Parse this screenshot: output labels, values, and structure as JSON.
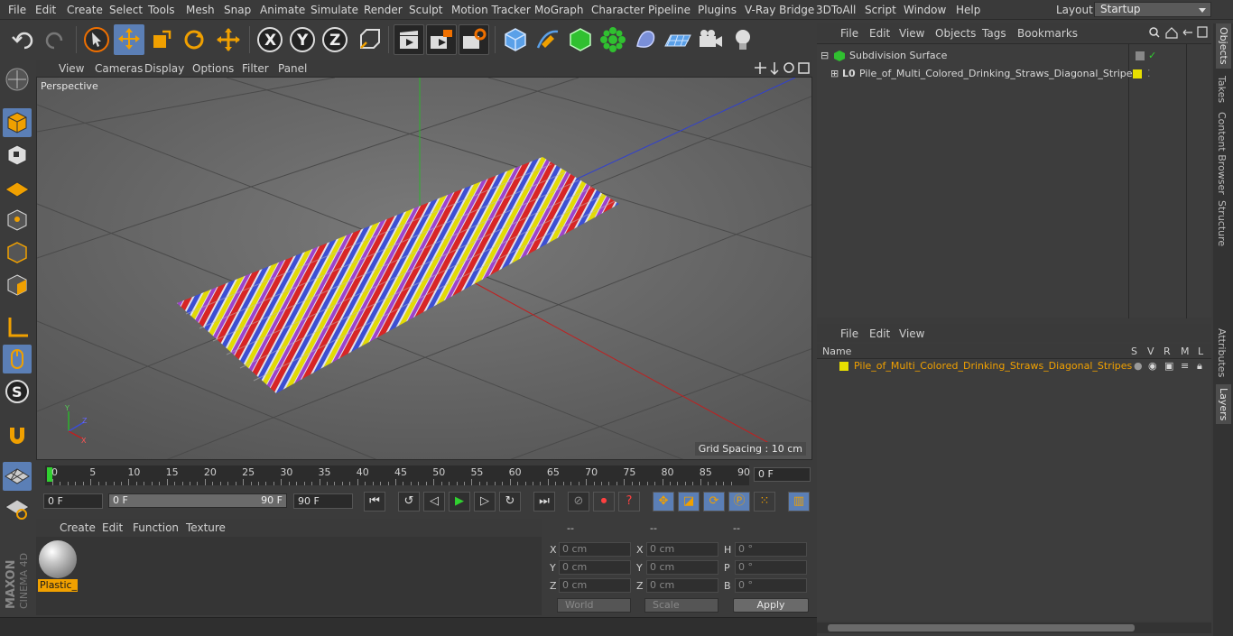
{
  "menu": [
    "File",
    "Edit",
    "Create",
    "Select",
    "Tools",
    "Mesh",
    "Snap",
    "Animate",
    "Simulate",
    "Render",
    "Sculpt",
    "Motion Tracker",
    "MoGraph",
    "Character",
    "Pipeline",
    "Plugins",
    "V-Ray Bridge",
    "3DToAll",
    "Script",
    "Window",
    "Help"
  ],
  "layout": {
    "label": "Layout:",
    "value": "Startup"
  },
  "viewport": {
    "menu": [
      "View",
      "Cameras",
      "Display",
      "Options",
      "Filter",
      "Panel"
    ],
    "camera_label": "Perspective",
    "grid_spacing": "Grid Spacing : 10 cm"
  },
  "timeline": {
    "ticks": [
      "0",
      "5",
      "10",
      "15",
      "20",
      "25",
      "30",
      "35",
      "40",
      "45",
      "50",
      "55",
      "60",
      "65",
      "70",
      "75",
      "80",
      "85",
      "90"
    ],
    "current_frame": "0 F"
  },
  "transport": {
    "start_field": "0 F",
    "range_start": "0 F",
    "range_end": "90 F",
    "end_field": "90 F"
  },
  "material_panel": {
    "menu": [
      "Create",
      "Edit",
      "Function",
      "Texture"
    ],
    "material_name": "Plastic_D"
  },
  "coords": {
    "headers": [
      "--",
      "--",
      "--"
    ],
    "rows": [
      {
        "l1": "X",
        "v1": "0 cm",
        "l2": "X",
        "v2": "0 cm",
        "l3": "H",
        "v3": "0 °"
      },
      {
        "l1": "Y",
        "v1": "0 cm",
        "l2": "Y",
        "v2": "0 cm",
        "l3": "P",
        "v3": "0 °"
      },
      {
        "l1": "Z",
        "v1": "0 cm",
        "l2": "Z",
        "v2": "0 cm",
        "l3": "B",
        "v3": "0 °"
      }
    ],
    "world": "World",
    "scale": "Scale",
    "apply": "Apply"
  },
  "objects_panel": {
    "menu": [
      "File",
      "Edit",
      "View",
      "Objects",
      "Tags",
      "Bookmarks"
    ],
    "items": [
      {
        "name": "Subdivision Surface"
      },
      {
        "name": "Pile_of_Multi_Colored_Drinking_Straws_Diagonal_Stripes"
      }
    ]
  },
  "layers_panel": {
    "menu": [
      "File",
      "Edit",
      "View"
    ],
    "columns": {
      "name": "Name",
      "s": "S",
      "v": "V",
      "r": "R",
      "m": "M",
      "l": "L"
    },
    "items": [
      {
        "name": "Pile_of_Multi_Colored_Drinking_Straws_Diagonal_Stripes",
        "color": "#e8e000"
      }
    ]
  },
  "right_tabs": [
    "Objects",
    "Takes",
    "Content Browser",
    "Structure",
    "Attributes",
    "Layers"
  ],
  "logo": {
    "line1": "MAXON",
    "line2": "CINEMA 4D"
  },
  "colors": {
    "accent": "#5b7fb6",
    "highlight": "#f0a000",
    "layer": "#e8e000"
  }
}
